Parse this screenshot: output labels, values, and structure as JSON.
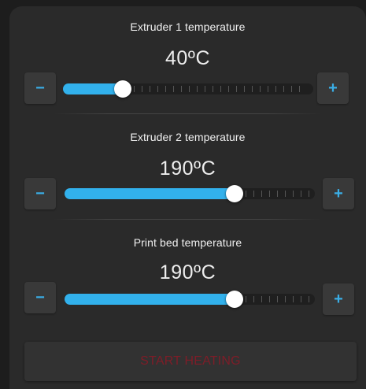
{
  "extruder1": {
    "title": "Extruder 1 temperature",
    "value": "40ºC",
    "level": 0.24,
    "minus_label": "−",
    "plus_label": "+"
  },
  "extruder2": {
    "title": "Extruder 2 temperature",
    "value": "190ºC",
    "level": 0.68,
    "minus_label": "−",
    "plus_label": "+"
  },
  "bed": {
    "title": "Print bed temperature",
    "value": "190ºC",
    "level": 0.68,
    "minus_label": "−",
    "plus_label": "+"
  },
  "actions": {
    "start_label": "START HEATING"
  },
  "colors": {
    "accent": "#32b1ec",
    "start_text": "#7e1d28",
    "panel": "#2a2a2a"
  }
}
